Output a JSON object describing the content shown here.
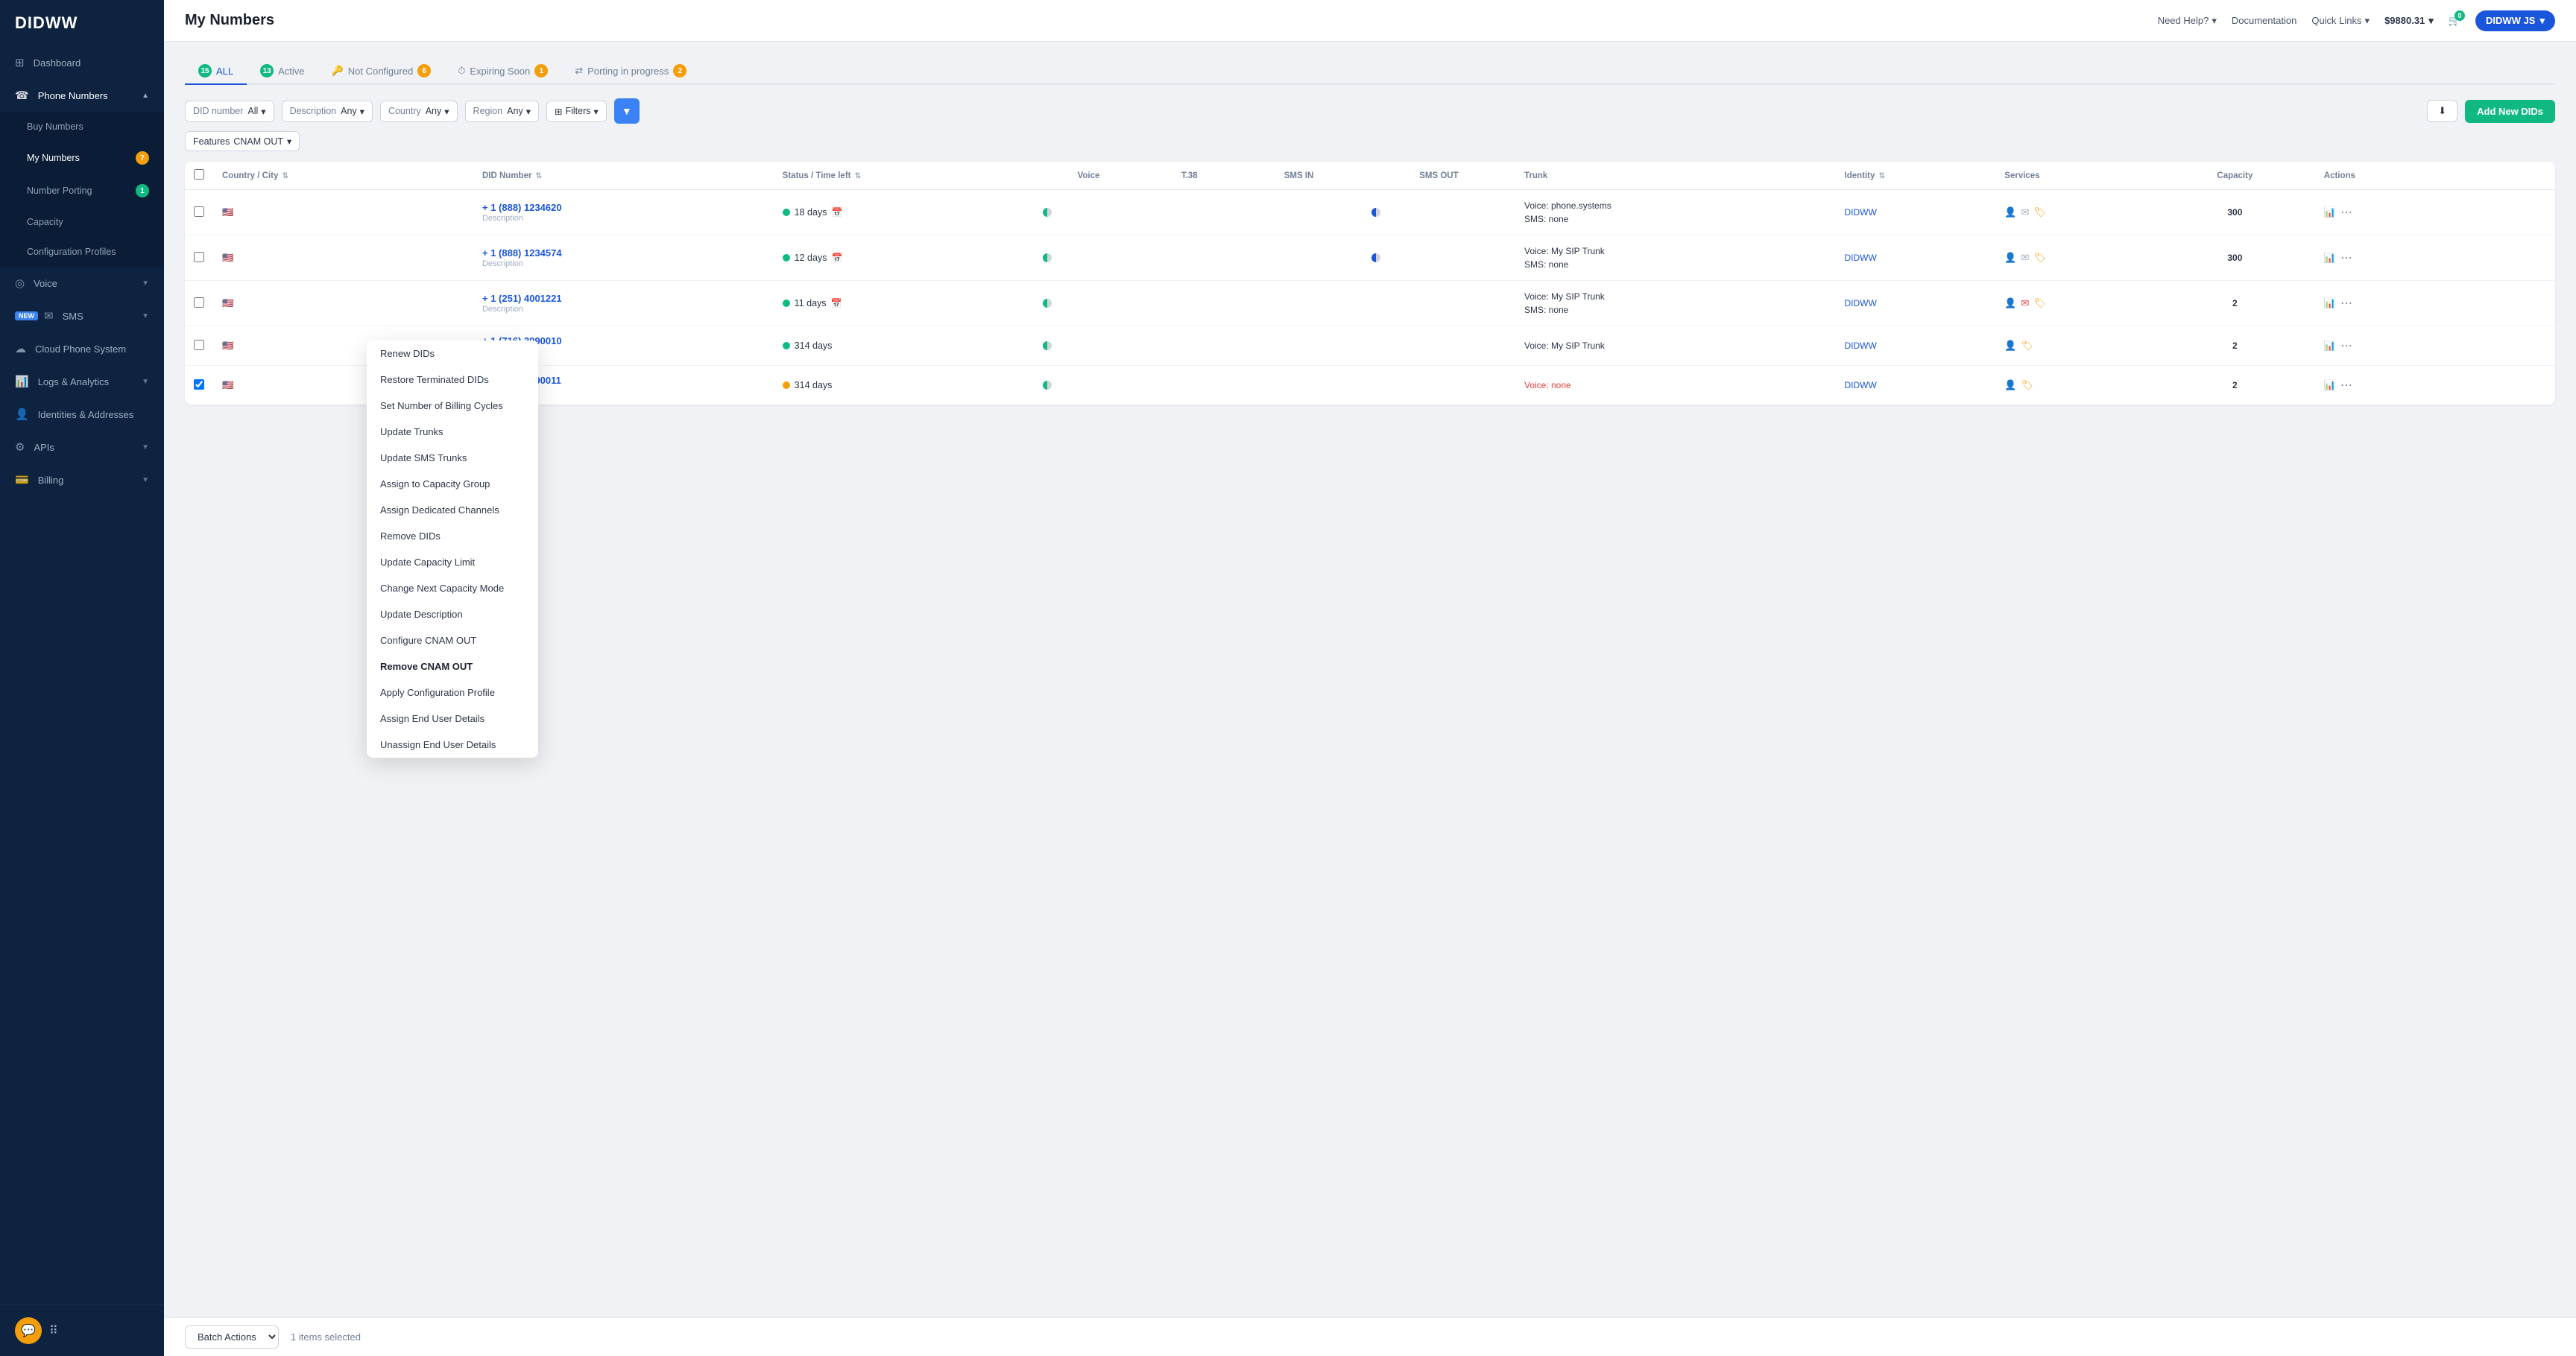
{
  "app": {
    "logo": "DIDWW"
  },
  "header": {
    "title": "My Numbers",
    "need_help": "Need Help?",
    "documentation": "Documentation",
    "quick_links": "Quick Links",
    "balance": "$9880.31",
    "user": "DIDWW JS"
  },
  "sidebar": {
    "items": [
      {
        "id": "dashboard",
        "label": "Dashboard",
        "icon": "⊞"
      },
      {
        "id": "phone-numbers",
        "label": "Phone Numbers",
        "icon": "☎",
        "expanded": true,
        "arrow": "▲"
      },
      {
        "id": "buy-numbers",
        "label": "Buy Numbers",
        "icon": "",
        "sub": true
      },
      {
        "id": "my-numbers",
        "label": "My Numbers",
        "icon": "",
        "sub": true,
        "badge": "7",
        "badgeColor": "orange",
        "active": true
      },
      {
        "id": "number-porting",
        "label": "Number Porting",
        "icon": "",
        "sub": true,
        "badge": "1",
        "badgeColor": "green"
      },
      {
        "id": "capacity",
        "label": "Capacity",
        "icon": "",
        "sub": true
      },
      {
        "id": "configuration-profiles",
        "label": "Configuration Profiles",
        "icon": "",
        "sub": true
      },
      {
        "id": "voice",
        "label": "Voice",
        "icon": "◎",
        "arrow": "▼"
      },
      {
        "id": "sms",
        "label": "SMS",
        "icon": "✉",
        "arrow": "▼",
        "new": true
      },
      {
        "id": "cloud-phone",
        "label": "Cloud Phone System",
        "icon": "☁"
      },
      {
        "id": "logs-analytics",
        "label": "Logs & Analytics",
        "icon": "📊",
        "arrow": "▼"
      },
      {
        "id": "identities",
        "label": "Identities & Addresses",
        "icon": "👤"
      },
      {
        "id": "apis",
        "label": "APIs",
        "icon": "⚙",
        "arrow": "▼"
      },
      {
        "id": "billing",
        "label": "Billing",
        "icon": "💳",
        "arrow": "▼"
      }
    ]
  },
  "tabs": [
    {
      "id": "all",
      "label": "ALL",
      "badge": "15",
      "badgeColor": "green",
      "active": true
    },
    {
      "id": "active",
      "label": "Active",
      "badge": "13",
      "badgeColor": "green"
    },
    {
      "id": "not-configured",
      "label": "Not Configured",
      "badge": "6",
      "badgeColor": "orange"
    },
    {
      "id": "expiring-soon",
      "label": "Expiring Soon",
      "badge": "1",
      "badgeColor": "orange"
    },
    {
      "id": "porting-in-progress",
      "label": "Porting in progress",
      "badge": "2",
      "badgeColor": "orange"
    }
  ],
  "filters": {
    "did_label": "DID number",
    "did_value": "All",
    "description_label": "Description",
    "description_value": "Any",
    "country_label": "Country",
    "country_value": "Any",
    "region_label": "Region",
    "region_value": "Any",
    "filters_label": "Filters",
    "features_label": "Features",
    "features_value": "CNAM OUT"
  },
  "buttons": {
    "add_new": "Add New DIDs",
    "batch_actions": "Batch Actions"
  },
  "table": {
    "columns": [
      "Country / City",
      "DID Number",
      "Status / Time left",
      "Voice",
      "T.38",
      "SMS IN",
      "SMS OUT",
      "Trunk",
      "Identity",
      "Services",
      "Capacity",
      "Actions"
    ],
    "rows": [
      {
        "country": "US",
        "city": "",
        "did": "+ 1 (888) 1234620",
        "description": "Description",
        "status_dot": "green",
        "status_days": "18 days",
        "voice": "half",
        "t38": "gray",
        "sms_in": "green",
        "sms_out": "half",
        "trunk_voice": "Voice: phone.systems",
        "trunk_sms": "SMS: none",
        "identity": "DIDWW",
        "capacity": "300",
        "has_msg_icon": true,
        "msg_red": false
      },
      {
        "country": "US",
        "city": "",
        "did": "+ 1 (888) 1234574",
        "description": "Description",
        "status_dot": "green",
        "status_days": "12 days",
        "voice": "half",
        "t38": "gray",
        "sms_in": "green",
        "sms_out": "half",
        "trunk_voice": "Voice: My SIP Trunk",
        "trunk_sms": "SMS: none",
        "identity": "DIDWW",
        "capacity": "300",
        "has_msg_icon": true,
        "msg_red": false
      },
      {
        "country": "US",
        "city": "",
        "did": "+ 1 (251) 4001221",
        "description": "Description",
        "status_dot": "green",
        "status_days": "11 days",
        "voice": "half",
        "t38": "gray",
        "sms_in": "green",
        "sms_out": "green",
        "trunk_voice": "Voice: My SIP Trunk",
        "trunk_sms": "SMS: none",
        "identity": "DIDWW",
        "capacity": "2",
        "has_msg_icon": true,
        "msg_red": true
      },
      {
        "country": "US",
        "city": "",
        "did": "+ 1 (716) 3990010",
        "description": "Description",
        "status_dot": "green",
        "status_days": "314 days",
        "voice": "half",
        "t38": "gray",
        "sms_in": "gray",
        "sms_out": "gray",
        "trunk_voice": "Voice: My SIP Trunk",
        "trunk_sms": "",
        "identity": "DIDWW",
        "capacity": "2",
        "has_msg_icon": false,
        "msg_red": false
      },
      {
        "country": "US",
        "city": "",
        "did": "+ 1 (716) 3990011",
        "description": "Description",
        "status_dot": "yellow",
        "status_days": "314 days",
        "voice": "half",
        "t38": "gray",
        "sms_in": "gray",
        "sms_out": "gray",
        "trunk_voice": "Voice: none",
        "trunk_sms": "",
        "identity": "DIDWW",
        "capacity": "2",
        "has_msg_icon": false,
        "msg_red": false,
        "trunk_red": true
      }
    ]
  },
  "dropdown_menu": {
    "items": [
      "Renew DIDs",
      "Restore Terminated DIDs",
      "Set Number of Billing Cycles",
      "Update Trunks",
      "Update SMS Trunks",
      "Assign to Capacity Group",
      "Assign Dedicated Channels",
      "Remove DIDs",
      "Update Capacity Limit",
      "Change Next Capacity Mode",
      "Update Description",
      "Configure CNAM OUT",
      "Remove CNAM OUT",
      "Apply Configuration Profile",
      "Assign End User Details",
      "Unassign End User Details"
    ],
    "highlighted_index": 12
  },
  "bottom_bar": {
    "batch_label": "Batch Actions",
    "selected_text": "1 items selected"
  }
}
